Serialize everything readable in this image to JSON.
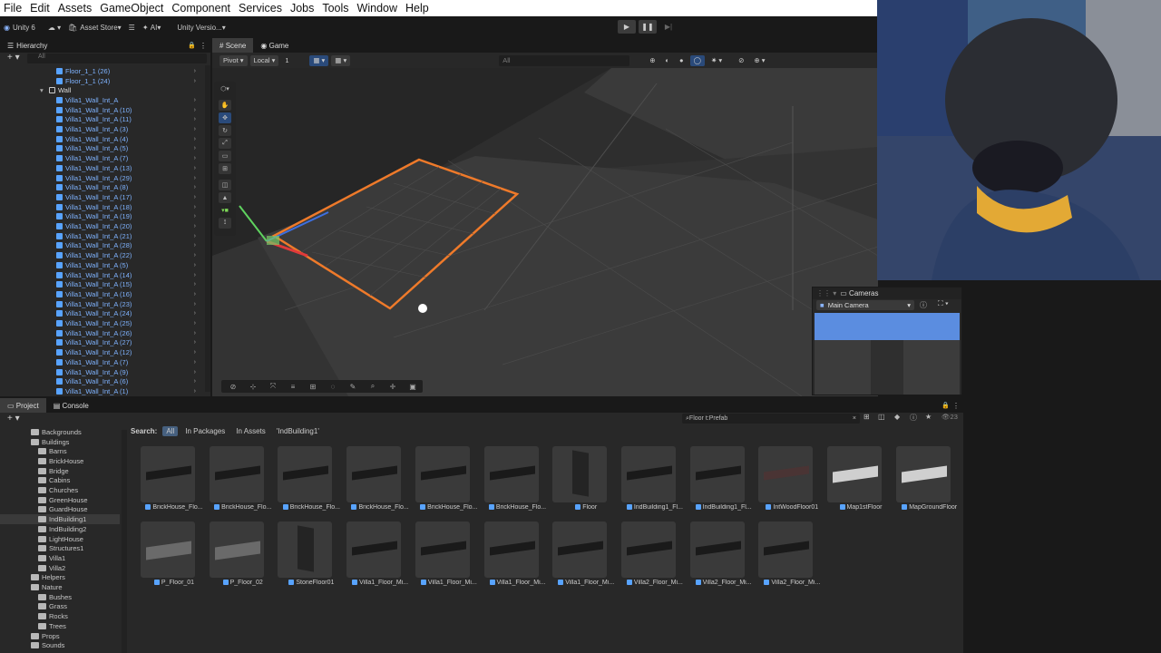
{
  "menu": [
    "File",
    "Edit",
    "Assets",
    "GameObject",
    "Component",
    "Services",
    "Jobs",
    "Tools",
    "Window",
    "Help"
  ],
  "toolbar": {
    "account": "Unity 6",
    "asset_store": "Asset Store",
    "ai": "AI",
    "version": "Unity Versio..."
  },
  "hierarchy": {
    "title": "Hierarchy",
    "search_placeholder": "All",
    "rows": [
      {
        "label": "Floor_1_1 (26)",
        "indent": 62
      },
      {
        "label": "Floor_1_1 (24)",
        "indent": 62
      },
      {
        "label": "Wall",
        "indent": 54,
        "expanded": true
      },
      {
        "label": "Villa1_Wall_Int_A",
        "indent": 62
      },
      {
        "label": "Villa1_Wall_Int_A (10)",
        "indent": 62
      },
      {
        "label": "Villa1_Wall_Int_A (11)",
        "indent": 62
      },
      {
        "label": "Villa1_Wall_Int_A (3)",
        "indent": 62
      },
      {
        "label": "Villa1_Wall_Int_A (4)",
        "indent": 62
      },
      {
        "label": "Villa1_Wall_Int_A (5)",
        "indent": 62
      },
      {
        "label": "Villa1_Wall_Int_A (7)",
        "indent": 62
      },
      {
        "label": "Villa1_Wall_Int_A (13)",
        "indent": 62
      },
      {
        "label": "Villa1_Wall_Int_A (29)",
        "indent": 62
      },
      {
        "label": "Villa1_Wall_Int_A (8)",
        "indent": 62
      },
      {
        "label": "Villa1_Wall_Int_A (17)",
        "indent": 62
      },
      {
        "label": "Villa1_Wall_Int_A (18)",
        "indent": 62
      },
      {
        "label": "Villa1_Wall_Int_A (19)",
        "indent": 62
      },
      {
        "label": "Villa1_Wall_Int_A (20)",
        "indent": 62
      },
      {
        "label": "Villa1_Wall_Int_A (21)",
        "indent": 62
      },
      {
        "label": "Villa1_Wall_Int_A (28)",
        "indent": 62
      },
      {
        "label": "Villa1_Wall_Int_A (22)",
        "indent": 62
      },
      {
        "label": "Villa1_Wall_Int_A (5)",
        "indent": 62
      },
      {
        "label": "Villa1_Wall_Int_A (14)",
        "indent": 62
      },
      {
        "label": "Villa1_Wall_Int_A (15)",
        "indent": 62
      },
      {
        "label": "Villa1_Wall_Int_A (16)",
        "indent": 62
      },
      {
        "label": "Villa1_Wall_Int_A (23)",
        "indent": 62
      },
      {
        "label": "Villa1_Wall_Int_A (24)",
        "indent": 62
      },
      {
        "label": "Villa1_Wall_Int_A (25)",
        "indent": 62
      },
      {
        "label": "Villa1_Wall_Int_A (26)",
        "indent": 62
      },
      {
        "label": "Villa1_Wall_Int_A (27)",
        "indent": 62
      },
      {
        "label": "Villa1_Wall_Int_A (12)",
        "indent": 62
      },
      {
        "label": "Villa1_Wall_Int_A (7)",
        "indent": 62
      },
      {
        "label": "Villa1_Wall_Int_A (9)",
        "indent": 62
      },
      {
        "label": "Villa1_Wall_Int_A (6)",
        "indent": 62
      },
      {
        "label": "Villa1_Wall_Int_A (1)",
        "indent": 62
      }
    ]
  },
  "scene": {
    "tabs": [
      "Scene",
      "Game"
    ],
    "pivot": "Pivot",
    "local": "Local",
    "grid_value": "1",
    "search_placeholder": "All"
  },
  "cameras": {
    "title": "Cameras",
    "selected": "Main Camera"
  },
  "project": {
    "tabs": [
      "Project",
      "Console"
    ],
    "search_query": "Floor t:Prefab",
    "count": "23",
    "search_label": "Search:",
    "scopes": [
      "All",
      "In Packages",
      "In Assets",
      "'IndBuilding1'"
    ],
    "folders": [
      {
        "label": "Backgrounds",
        "indent": 34
      },
      {
        "label": "Buildings",
        "indent": 34
      },
      {
        "label": "Barns",
        "indent": 42
      },
      {
        "label": "BrickHouse",
        "indent": 42
      },
      {
        "label": "Bridge",
        "indent": 42
      },
      {
        "label": "Cabins",
        "indent": 42
      },
      {
        "label": "Churches",
        "indent": 42
      },
      {
        "label": "GreenHouse",
        "indent": 42
      },
      {
        "label": "GuardHouse",
        "indent": 42
      },
      {
        "label": "IndBuilding1",
        "indent": 42,
        "selected": true
      },
      {
        "label": "IndBuilding2",
        "indent": 42
      },
      {
        "label": "LightHouse",
        "indent": 42
      },
      {
        "label": "Structures1",
        "indent": 42
      },
      {
        "label": "Villa1",
        "indent": 42
      },
      {
        "label": "Villa2",
        "indent": 42
      },
      {
        "label": "Helpers",
        "indent": 34
      },
      {
        "label": "Nature",
        "indent": 34
      },
      {
        "label": "Bushes",
        "indent": 42
      },
      {
        "label": "Grass",
        "indent": 42
      },
      {
        "label": "Rocks",
        "indent": 42
      },
      {
        "label": "Trees",
        "indent": 42
      },
      {
        "label": "Props",
        "indent": 34
      },
      {
        "label": "Sounds",
        "indent": 34
      }
    ],
    "assets_row1": [
      "BrickHouse_Flo...",
      "BrickHouse_Flo...",
      "BrickHouse_Flo...",
      "BrickHouse_Flo...",
      "BrickHouse_Flo...",
      "BrickHouse_Flo...",
      "Floor",
      "IndBuilding1_Fl...",
      "IndBuilding1_Fl...",
      "IntWoodFloor01",
      "Map1stFloor",
      "MapGroundFloor"
    ],
    "assets_row2": [
      "P_Floor_01",
      "P_Floor_02",
      "StoneFloor01",
      "Villa1_Floor_Mi...",
      "Villa1_Floor_Mi...",
      "Villa1_Floor_Mi...",
      "Villa1_Floor_Mi...",
      "Villa2_Floor_Mi...",
      "Villa2_Floor_Mi...",
      "Villa2_Floor_Mi..."
    ]
  }
}
